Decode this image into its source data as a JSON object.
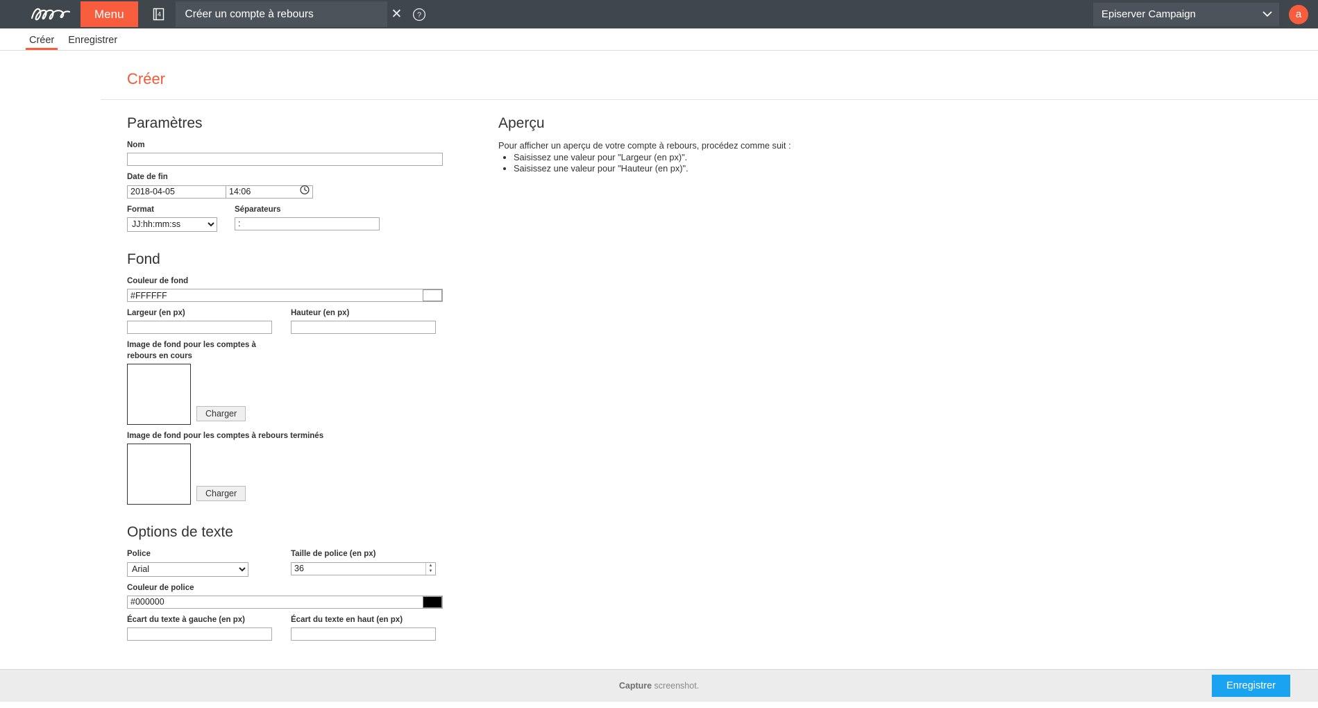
{
  "topbar": {
    "logo_alt": "episerver-logo",
    "menu_label": "Menu",
    "stack_badge": "4",
    "window_title": "Créer un compte à rebours",
    "close_glyph": "✕",
    "account_name": "Episerver Campaign",
    "avatar_initial": "a",
    "accent_color": "#f85e3d",
    "bar_color": "#3f464c"
  },
  "tabs": [
    {
      "label": "Créer",
      "active": true
    },
    {
      "label": "Enregistrer",
      "active": false
    }
  ],
  "page": {
    "title": "Créer",
    "title_color": "#f05a36"
  },
  "parametres": {
    "heading": "Paramètres",
    "nom": {
      "label": "Nom",
      "value": "",
      "placeholder": ""
    },
    "date_de_fin": {
      "label": "Date de fin",
      "date_value": "2018-04-05",
      "time_value": "14:06",
      "clock_icon": "clock-icon"
    },
    "format": {
      "label": "Format",
      "value": "JJ:hh:mm:ss",
      "options": [
        "JJ:hh:mm:ss"
      ]
    },
    "separateurs": {
      "label": "Séparateurs",
      "value": ":",
      "placeholder": ""
    }
  },
  "fond": {
    "heading": "Fond",
    "couleur_de_fond": {
      "label": "Couleur de fond",
      "value": "#FFFFFF",
      "swatch_color": "#FFFFFF"
    },
    "largeur": {
      "label": "Largeur (en px)",
      "value": "",
      "placeholder": ""
    },
    "hauteur": {
      "label": "Hauteur (en px)",
      "value": "",
      "placeholder": ""
    },
    "image_en_cours": {
      "label": "Image de fond pour les comptes à rebours en cours",
      "button_label": "Charger"
    },
    "image_termines": {
      "label": "Image de fond pour les comptes à rebours terminés",
      "button_label": "Charger"
    }
  },
  "options_de_texte": {
    "heading": "Options de texte",
    "police": {
      "label": "Police",
      "value": "Arial",
      "options": [
        "Arial"
      ]
    },
    "taille_de_police": {
      "label": "Taille de police (en px)",
      "value": "36"
    },
    "couleur_de_police": {
      "label": "Couleur de police",
      "value": "#000000",
      "swatch_color": "#000000"
    },
    "ecart_gauche": {
      "label": "Écart du texte à gauche (en px)",
      "value": ""
    },
    "ecart_haut": {
      "label": "Écart du texte en haut (en px)",
      "value": ""
    }
  },
  "apercu": {
    "heading": "Aperçu",
    "intro": "Pour afficher un aperçu de votre compte à rebours, procédez comme suit :",
    "hints": [
      "Saisissez une valeur pour \"Largeur (en px)\".",
      "Saisissez une valeur pour \"Hauteur (en px)\"."
    ]
  },
  "bottombar": {
    "capture_strong": "Capture",
    "capture_rest": " screenshot.",
    "save_label": "Enregistrer",
    "save_color": "#1aa3f0"
  }
}
